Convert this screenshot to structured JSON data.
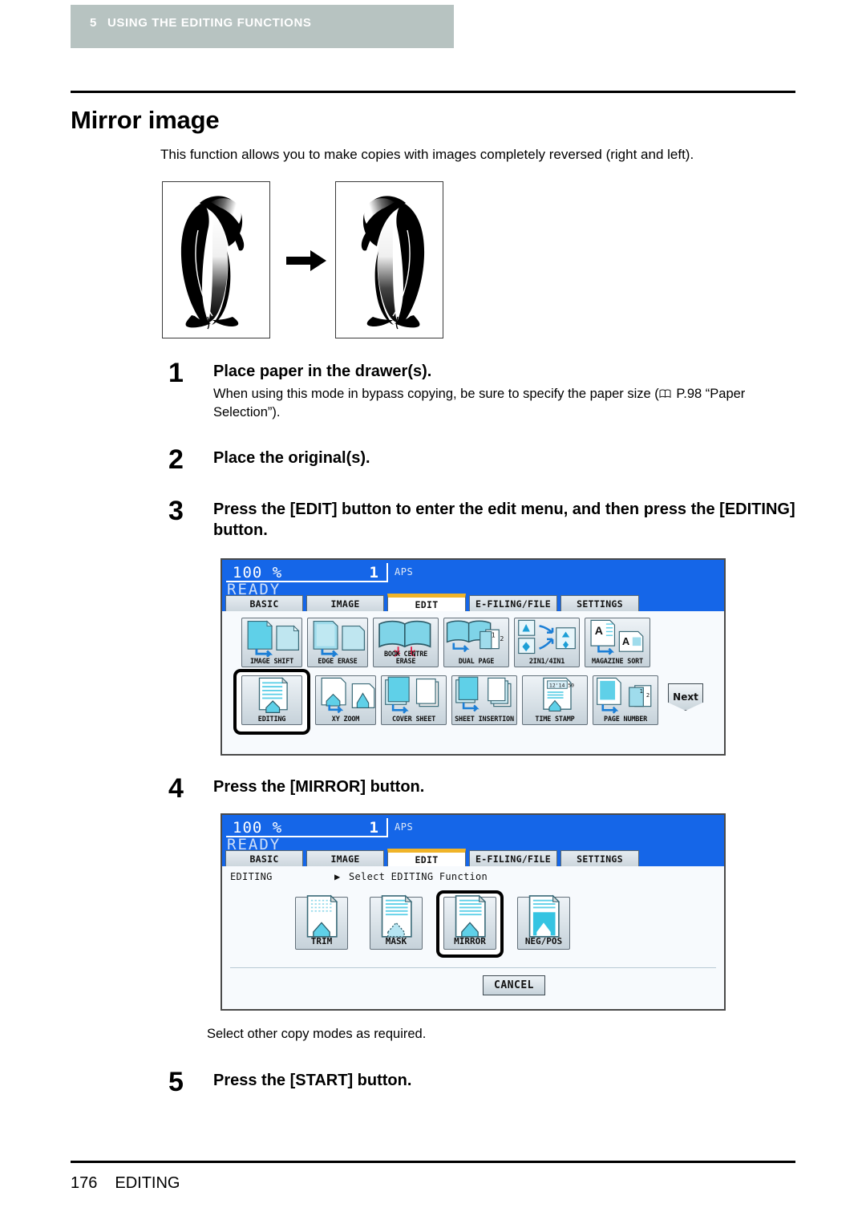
{
  "header": {
    "chapter_number": "5",
    "chapter_title": "USING THE EDITING FUNCTIONS",
    "bar_color": "#b7c3c1"
  },
  "page_title": "Mirror image",
  "intro": "This function allows you to make copies with images completely reversed (right and left).",
  "figure": {
    "left_caption": "original-penguin",
    "right_caption": "mirrored-penguin",
    "arrow": "right-arrow"
  },
  "steps": [
    {
      "number": "1",
      "heading": "Place paper in the drawer(s).",
      "body_before": "When using this mode in bypass copying, be sure to specify the paper size (",
      "body_ref": " P.98 “Paper Selection”).",
      "ref_icon": "book-icon"
    },
    {
      "number": "2",
      "heading": "Place the original(s)."
    },
    {
      "number": "3",
      "heading": "Press the [EDIT] button to enter the edit menu, and then press the [EDITING] button."
    },
    {
      "number": "4",
      "heading": "Press the [MIRROR] button."
    },
    {
      "number": "5",
      "heading": "Press the [START] button."
    }
  ],
  "note_after_panel2": "Select other copy modes as required.",
  "lcd": {
    "ratio": "100",
    "percent_symbol": "%",
    "copies": "1",
    "paper_mode": "APS",
    "status": "READY",
    "screen_color": "#1566e8",
    "active_tab_accent": "#f0b429",
    "tabs": [
      {
        "label": "BASIC",
        "active": false
      },
      {
        "label": "IMAGE",
        "active": false
      },
      {
        "label": "EDIT",
        "active": true
      },
      {
        "label": "E-FILING/FILE",
        "active": false
      },
      {
        "label": "SETTINGS",
        "active": false
      }
    ]
  },
  "edit_menu": {
    "row1": [
      {
        "label": "IMAGE SHIFT",
        "icon": "image-shift-icon",
        "selected": false
      },
      {
        "label": "EDGE ERASE",
        "icon": "edge-erase-icon",
        "selected": false
      },
      {
        "label": "BOOK CENTRE ERASE",
        "icon": "book-centre-erase-icon",
        "selected": false
      },
      {
        "label": "DUAL PAGE",
        "icon": "dual-page-icon",
        "selected": false
      },
      {
        "label": "2IN1/4IN1",
        "icon": "2in1-4in1-icon",
        "selected": false
      },
      {
        "label": "MAGAZINE SORT",
        "icon": "magazine-sort-icon",
        "selected": false
      }
    ],
    "row2": [
      {
        "label": "EDITING",
        "icon": "editing-icon",
        "selected": true
      },
      {
        "label": "XY ZOOM",
        "icon": "xy-zoom-icon",
        "selected": false
      },
      {
        "label": "COVER SHEET",
        "icon": "cover-sheet-icon",
        "selected": false
      },
      {
        "label": "SHEET INSERTION",
        "icon": "sheet-insertion-icon",
        "selected": false
      },
      {
        "label": "TIME STAMP",
        "icon": "time-stamp-icon",
        "selected": false
      },
      {
        "label": "PAGE NUMBER",
        "icon": "page-number-icon",
        "selected": false
      }
    ],
    "next_label": "Next"
  },
  "editing_menu": {
    "title": "EDITING",
    "prompt": "Select EDITING Function",
    "prompt_arrow": "▶",
    "buttons": [
      {
        "label": "TRIM",
        "icon": "trim-icon",
        "selected": false
      },
      {
        "label": "MASK",
        "icon": "mask-icon",
        "selected": false
      },
      {
        "label": "MIRROR",
        "icon": "mirror-icon",
        "selected": true
      },
      {
        "label": "NEG/POS",
        "icon": "neg-pos-icon",
        "selected": false
      }
    ],
    "cancel_label": "CANCEL"
  },
  "footer": {
    "page_number": "176",
    "section": "EDITING"
  }
}
